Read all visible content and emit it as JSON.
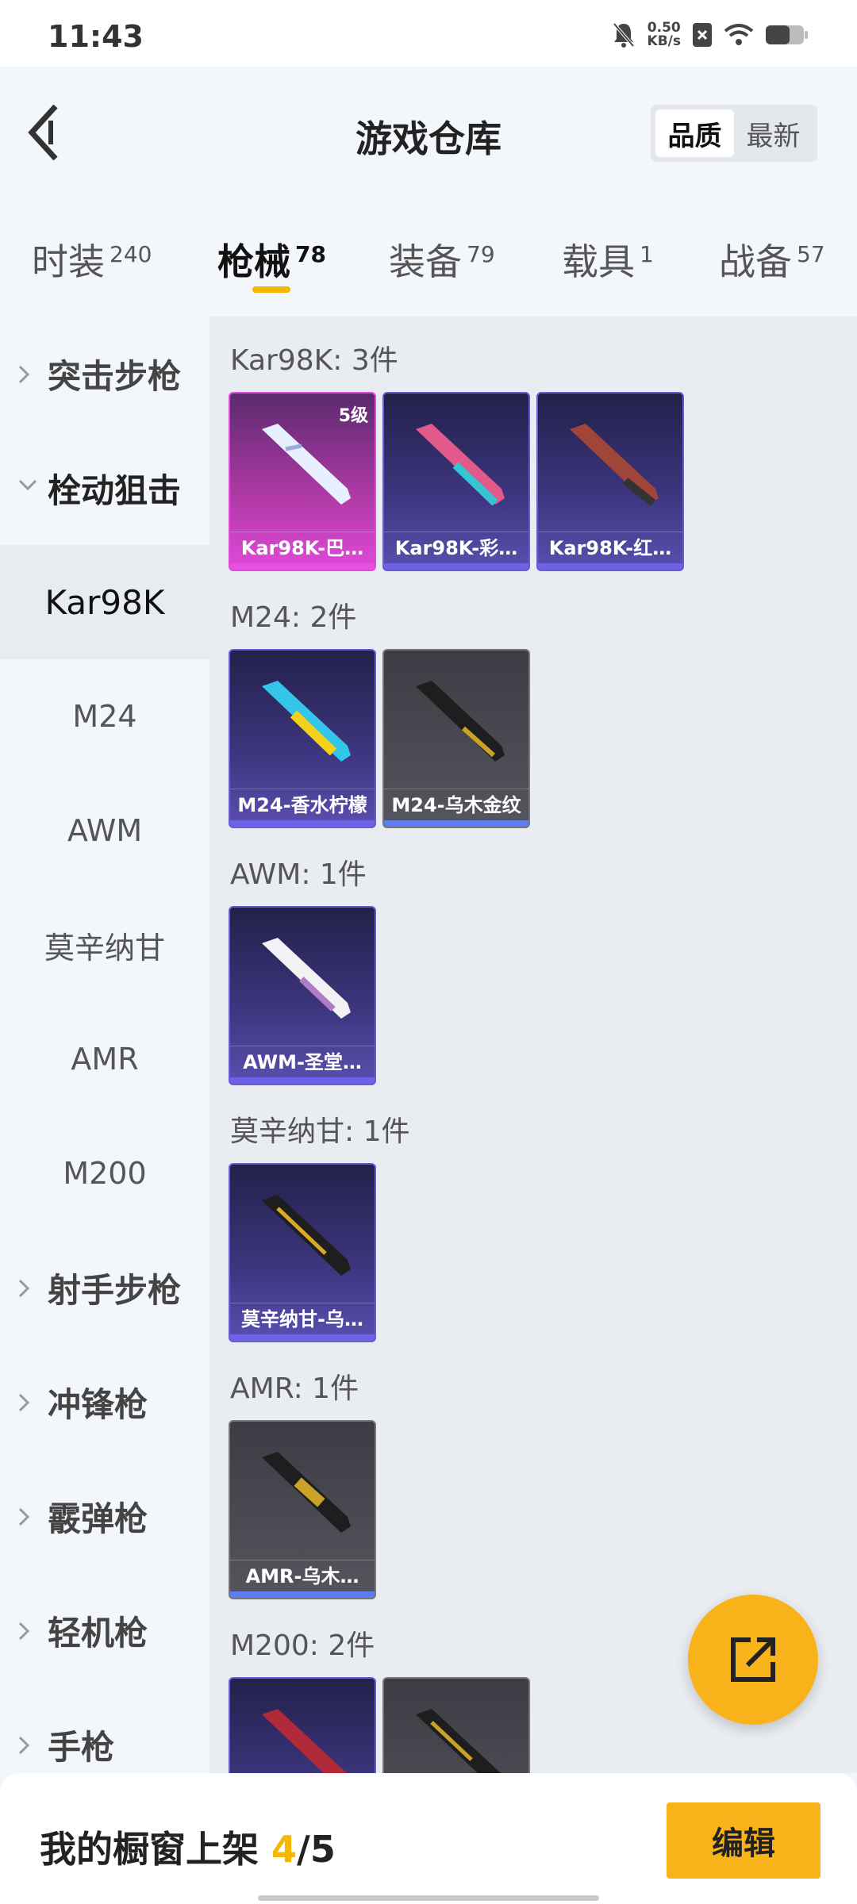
{
  "status": {
    "time": "11:43",
    "net_speed": "0.50",
    "net_unit": "KB/s"
  },
  "header": {
    "title": "游戏仓库",
    "sort_options": [
      "品质",
      "最新"
    ]
  },
  "tabs": [
    {
      "label": "时装",
      "count": "240"
    },
    {
      "label": "枪械",
      "count": "78"
    },
    {
      "label": "装备",
      "count": "79"
    },
    {
      "label": "载具",
      "count": "1"
    },
    {
      "label": "战备",
      "count": "57"
    }
  ],
  "sidebar": {
    "items": [
      {
        "label": "突击步枪"
      },
      {
        "label": "栓动狙击"
      },
      {
        "label": "Kar98K"
      },
      {
        "label": "M24"
      },
      {
        "label": "AWM"
      },
      {
        "label": "莫辛纳甘"
      },
      {
        "label": "AMR"
      },
      {
        "label": "M200"
      },
      {
        "label": "射手步枪"
      },
      {
        "label": "冲锋枪"
      },
      {
        "label": "霰弹枪"
      },
      {
        "label": "轻机枪"
      },
      {
        "label": "手枪"
      }
    ]
  },
  "groups": [
    {
      "title": "Kar98K: 3件",
      "items": [
        {
          "name": "Kar98K-巴…",
          "badge": "5级"
        },
        {
          "name": "Kar98K-彩…"
        },
        {
          "name": "Kar98K-红…"
        }
      ]
    },
    {
      "title": "M24: 2件",
      "items": [
        {
          "name": "M24-香水柠檬"
        },
        {
          "name": "M24-乌木金纹"
        }
      ]
    },
    {
      "title": "AWM: 1件",
      "items": [
        {
          "name": "AWM-圣堂…"
        }
      ]
    },
    {
      "title": "莫辛纳甘: 1件",
      "items": [
        {
          "name": "莫辛纳甘-乌…"
        }
      ]
    },
    {
      "title": "AMR: 1件",
      "items": [
        {
          "name": "AMR-乌木…"
        }
      ]
    },
    {
      "title": "M200: 2件",
      "items": []
    }
  ],
  "bottom": {
    "shelf_prefix": "我的橱窗上架 ",
    "shelf_count": "4",
    "shelf_total": "/5",
    "edit_label": "编辑"
  },
  "colors": {
    "accent": "#f8b31a",
    "pink_rarity": "#e04ad9",
    "purple_rarity": "#6c62e6",
    "gray_rarity": "#5d7df0"
  }
}
